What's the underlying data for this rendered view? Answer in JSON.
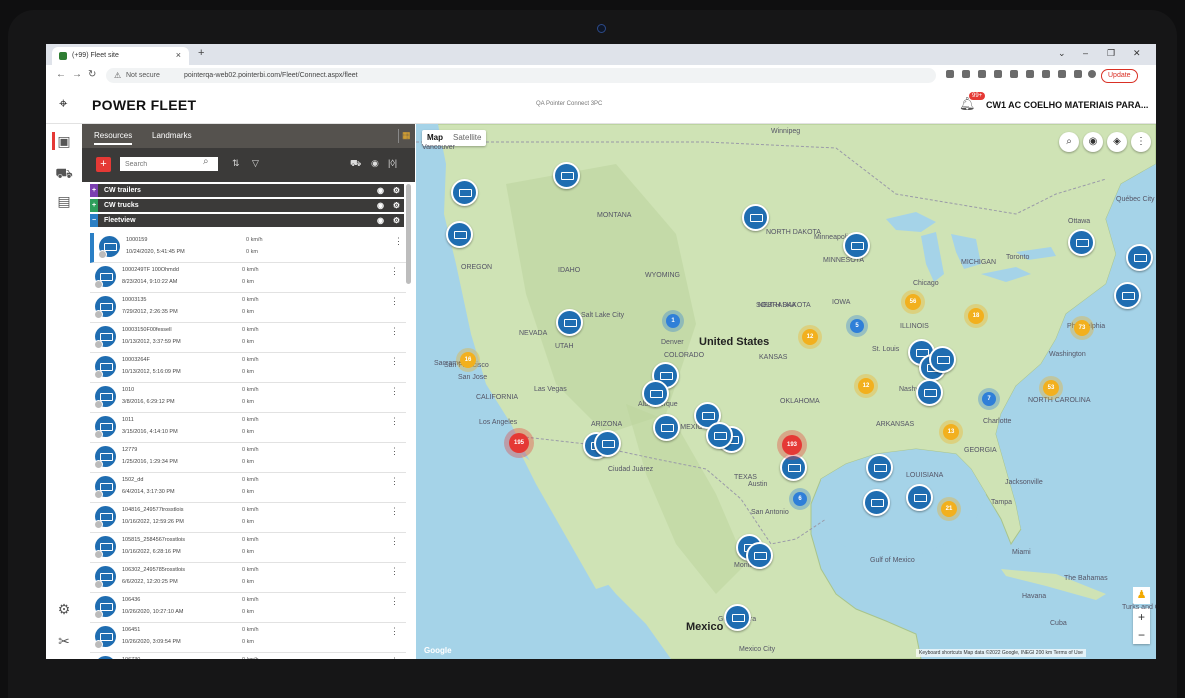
{
  "browser": {
    "tab_title": "(+99) Fleet site",
    "tab_close": "×",
    "new_tab": "+",
    "not_secure": "Not secure",
    "url": "pointerqa-web02.pointerbi.com/Fleet/Connect.aspx/fleet",
    "update_label": "Update"
  },
  "header": {
    "brand": "POWER FLEET",
    "environment": "QA Pointer Connect 3PC",
    "notification_count": "99+",
    "company": "CW1 AC COELHO MATERIAIS PARA..."
  },
  "panel": {
    "tabs": [
      "Resources",
      "Landmarks"
    ],
    "search_placeholder": "Search",
    "groups": [
      {
        "marker": "+",
        "label": "CW trailers",
        "color": "#7b3fb0"
      },
      {
        "marker": "+",
        "label": "CW trucks",
        "color": "#2e9e5b"
      },
      {
        "marker": "−",
        "label": "Fleetview",
        "color": "#2a7fc5"
      }
    ],
    "rows": [
      {
        "name": "1000159",
        "time": "10/24/2020, 5:41:45 PM",
        "speed": "0 km/h",
        "dist": "0 km"
      },
      {
        "name": "1000249TF 100Ohmdd",
        "time": "8/23/2014, 9:10:22 AM",
        "speed": "0 km/h",
        "dist": "0 km"
      },
      {
        "name": "10003135",
        "time": "7/29/2012, 2:26:35 PM",
        "speed": "0 km/h",
        "dist": "0 km"
      },
      {
        "name": "10003150F00fessell",
        "time": "10/13/2012, 3:37:59 PM",
        "speed": "0 km/h",
        "dist": "0 km"
      },
      {
        "name": "10003264F",
        "time": "10/13/2012, 5:16:09 PM",
        "speed": "0 km/h",
        "dist": "0 km"
      },
      {
        "name": "1010",
        "time": "3/8/2016, 6:29:12 PM",
        "speed": "0 km/h",
        "dist": "0 km"
      },
      {
        "name": "1011",
        "time": "3/15/2016, 4:14:10 PM",
        "speed": "0 km/h",
        "dist": "0 km"
      },
      {
        "name": "12779",
        "time": "1/25/2016, 1:29:34 PM",
        "speed": "0 km/h",
        "dist": "0 km"
      },
      {
        "name": "1502_dd",
        "time": "6/4/2014, 3:17:30 PM",
        "speed": "0 km/h",
        "dist": "0 km"
      },
      {
        "name": "104816_249577trosstlois",
        "time": "10/16/2022, 12:59:26 PM",
        "speed": "0 km/h",
        "dist": "0 km"
      },
      {
        "name": "105815_2584567rosstlois",
        "time": "10/16/2022, 6:28:16 PM",
        "speed": "0 km/h",
        "dist": "0 km"
      },
      {
        "name": "106302_2495785rosstlois",
        "time": "6/6/2022, 12:20:25 PM",
        "speed": "0 km/h",
        "dist": "0 km"
      },
      {
        "name": "106436",
        "time": "10/26/2020, 10:27:10 AM",
        "speed": "0 km/h",
        "dist": "0 km"
      },
      {
        "name": "106451",
        "time": "10/26/2020, 3:09:54 PM",
        "speed": "0 km/h",
        "dist": "0 km"
      },
      {
        "name": "106730",
        "time": "",
        "speed": "0 km/h",
        "dist": ""
      }
    ]
  },
  "map": {
    "type_map": "Map",
    "type_satellite": "Satellite",
    "google": "Google",
    "attribution": "Keyboard shortcuts   Map data ©2022 Google, INEGI   200 km   Terms of Use",
    "water_color": "#a5d3e8",
    "land_color": "#cfe3b5",
    "labels": [
      {
        "text": "United States",
        "big": true
      },
      {
        "text": "Mexico",
        "big": true
      },
      {
        "text": "Denver"
      },
      {
        "text": "Las Vegas"
      },
      {
        "text": "Los Angeles"
      },
      {
        "text": "Albuquerque"
      },
      {
        "text": "Ciudad Juárez"
      },
      {
        "text": "San Antonio"
      },
      {
        "text": "Austin"
      },
      {
        "text": "Monterrey"
      },
      {
        "text": "St. Louis"
      },
      {
        "text": "Nashville"
      },
      {
        "text": "Charlotte"
      },
      {
        "text": "Chicago"
      },
      {
        "text": "Toronto"
      },
      {
        "text": "Ottawa"
      },
      {
        "text": "Québec City"
      },
      {
        "text": "Philadelphia"
      },
      {
        "text": "Washington"
      },
      {
        "text": "Jacksonville"
      },
      {
        "text": "Tampa"
      },
      {
        "text": "Miami"
      },
      {
        "text": "Cuba"
      },
      {
        "text": "Havana"
      },
      {
        "text": "Winnipeg"
      },
      {
        "text": "Vancouver"
      },
      {
        "text": "Sacramento"
      },
      {
        "text": "San Francisco"
      },
      {
        "text": "San Jose"
      },
      {
        "text": "Salt Lake City"
      },
      {
        "text": "NEVADA"
      },
      {
        "text": "UTAH"
      },
      {
        "text": "COLORADO"
      },
      {
        "text": "KANSAS"
      },
      {
        "text": "OKLAHOMA"
      },
      {
        "text": "ARKANSAS"
      },
      {
        "text": "TEXAS"
      },
      {
        "text": "NEBRASKA"
      },
      {
        "text": "IOWA"
      },
      {
        "text": "MONTANA"
      },
      {
        "text": "WYOMING"
      },
      {
        "text": "IDAHO"
      },
      {
        "text": "OREGON"
      },
      {
        "text": "NORTH DAKOTA"
      },
      {
        "text": "SOUTH DAKOTA"
      },
      {
        "text": "MINNESOTA"
      },
      {
        "text": "MICHIGAN"
      },
      {
        "text": "ILLINOIS"
      },
      {
        "text": "Minneapolis"
      },
      {
        "text": "Guadalajara"
      },
      {
        "text": "Mexico City"
      },
      {
        "text": "The Bahamas"
      },
      {
        "text": "Gulf of Mexico"
      },
      {
        "text": "CALIFORNIA"
      },
      {
        "text": "ARIZONA"
      },
      {
        "text": "NEW MEXICO"
      },
      {
        "text": "LOUISIANA"
      },
      {
        "text": "GEORGIA"
      },
      {
        "text": "NORTH CAROLINA"
      },
      {
        "text": "Turks and Caicos Islands"
      }
    ],
    "clusters": [
      {
        "count": "195",
        "kind": "r"
      },
      {
        "count": "193",
        "kind": "r"
      },
      {
        "count": "56",
        "kind": "y"
      },
      {
        "count": "18",
        "kind": "y"
      },
      {
        "count": "12",
        "kind": "y"
      },
      {
        "count": "73",
        "kind": "y"
      },
      {
        "count": "16",
        "kind": "y"
      },
      {
        "count": "12",
        "kind": "y"
      },
      {
        "count": "53",
        "kind": "y"
      },
      {
        "count": "13",
        "kind": "y"
      },
      {
        "count": "21",
        "kind": "y"
      },
      {
        "count": "1",
        "kind": "b"
      },
      {
        "count": "5",
        "kind": "b"
      },
      {
        "count": "6",
        "kind": "b"
      },
      {
        "count": "7",
        "kind": "b"
      }
    ]
  }
}
